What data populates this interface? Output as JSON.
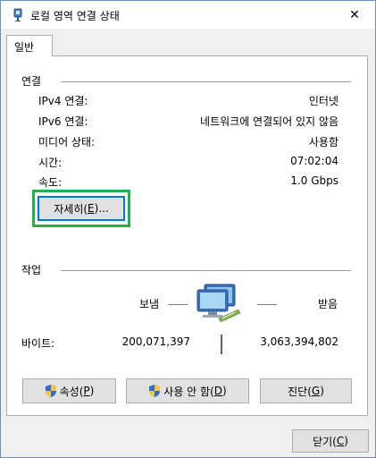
{
  "window": {
    "title": "로컬 영역 연결 상태",
    "close_glyph": "✕"
  },
  "tab": {
    "label": "일반"
  },
  "connection": {
    "heading": "연결",
    "rows": [
      {
        "label": "IPv4 연결:",
        "value": "인터넷"
      },
      {
        "label": "IPv6 연결:",
        "value": "네트워크에 연결되어 있지 않음"
      },
      {
        "label": "미디어 상태:",
        "value": "사용함"
      },
      {
        "label": "시간:",
        "value": "07:02:04"
      },
      {
        "label": "속도:",
        "value": "1.0 Gbps"
      }
    ],
    "details_button": {
      "text": "자세히(",
      "accel": "E",
      "suffix": ")..."
    }
  },
  "activity": {
    "heading": "작업",
    "sent_label": "보냄",
    "received_label": "받음",
    "bytes_label": "바이트:",
    "bytes_sent": "200,071,397",
    "bytes_received": "3,063,394,802"
  },
  "buttons": {
    "properties": {
      "text": "속성(",
      "accel": "P",
      "suffix": ")"
    },
    "disable": {
      "text": "사용 안 함(",
      "accel": "D",
      "suffix": ")"
    },
    "diagnose": {
      "text": "진단(",
      "accel": "G",
      "suffix": ")"
    },
    "close": {
      "text": "닫기(",
      "accel": "C",
      "suffix": ")"
    }
  },
  "colors": {
    "highlight": "#22b14c",
    "focus_border": "#0078d7"
  }
}
